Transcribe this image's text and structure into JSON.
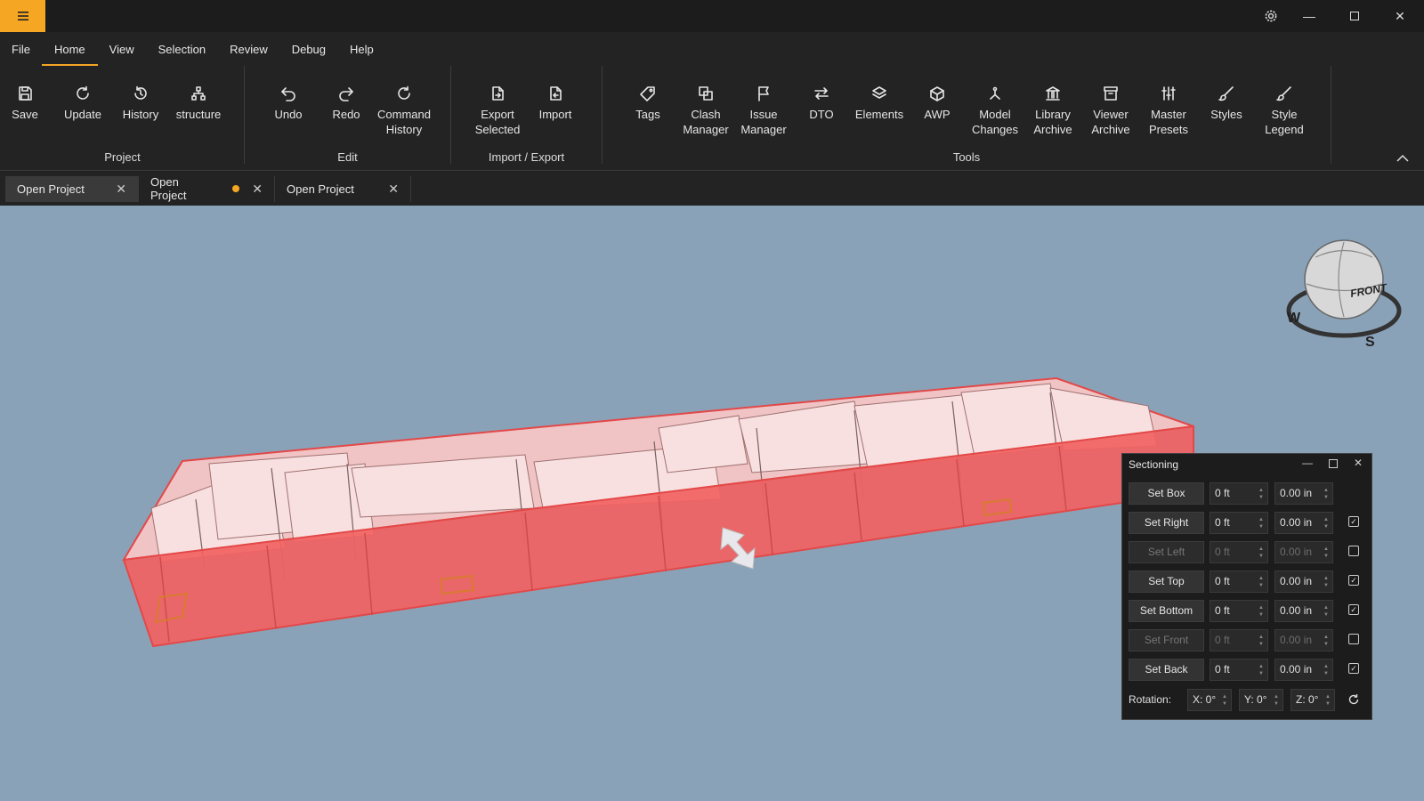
{
  "menu": {
    "items": [
      "File",
      "Home",
      "View",
      "Selection",
      "Review",
      "Debug",
      "Help"
    ],
    "active": "Home"
  },
  "ribbon": {
    "project": {
      "label": "Project",
      "save": "Save",
      "update": "Update",
      "history": "History",
      "structure": "structure"
    },
    "edit": {
      "label": "Edit",
      "undo": "Undo",
      "redo": "Redo",
      "command_history": "Command\nHistory"
    },
    "import_export": {
      "label": "Import / Export",
      "export_selected": "Export\nSelected",
      "import": "Import"
    },
    "tools": {
      "label": "Tools",
      "tags": "Tags",
      "clash": "Clash\nManager",
      "issue": "Issue\nManager",
      "dto": "DTO",
      "elements": "Elements",
      "awp": "AWP",
      "model_changes": "Model\nChanges",
      "library": "Library\nArchive",
      "viewer": "Viewer\nArchive",
      "master": "Master\nPresets",
      "styles": "Styles",
      "style_legend": "Style\nLegend"
    }
  },
  "tabs": [
    {
      "label": "Open Project",
      "active": true,
      "modified": false
    },
    {
      "label": "Open Project",
      "active": false,
      "modified": true
    },
    {
      "label": "Open Project",
      "active": false,
      "modified": false
    }
  ],
  "viewcube": {
    "face": "FRONT",
    "west": "W",
    "south": "S"
  },
  "sectioning": {
    "title": "Sectioning",
    "rows": [
      {
        "button": "Set Box",
        "ft": "0 ft",
        "in": "0.00 in",
        "enabled": true,
        "checkbox": false,
        "checked": false
      },
      {
        "button": "Set Right",
        "ft": "0 ft",
        "in": "0.00 in",
        "enabled": true,
        "checkbox": true,
        "checked": true
      },
      {
        "button": "Set Left",
        "ft": "0 ft",
        "in": "0.00 in",
        "enabled": false,
        "checkbox": true,
        "checked": false
      },
      {
        "button": "Set Top",
        "ft": "0 ft",
        "in": "0.00 in",
        "enabled": true,
        "checkbox": true,
        "checked": true
      },
      {
        "button": "Set Bottom",
        "ft": "0 ft",
        "in": "0.00 in",
        "enabled": true,
        "checkbox": true,
        "checked": true
      },
      {
        "button": "Set Front",
        "ft": "0 ft",
        "in": "0.00 in",
        "enabled": false,
        "checkbox": true,
        "checked": false
      },
      {
        "button": "Set Back",
        "ft": "0 ft",
        "in": "0.00 in",
        "enabled": true,
        "checkbox": true,
        "checked": true
      }
    ],
    "rotation_label": "Rotation:",
    "rot_x": "X: 0°",
    "rot_y": "Y: 0°",
    "rot_z": "Z: 0°"
  },
  "colors": {
    "accent": "#f5a623",
    "viewport_bg": "#8aa2b8",
    "section_red": "#f05a5a"
  }
}
